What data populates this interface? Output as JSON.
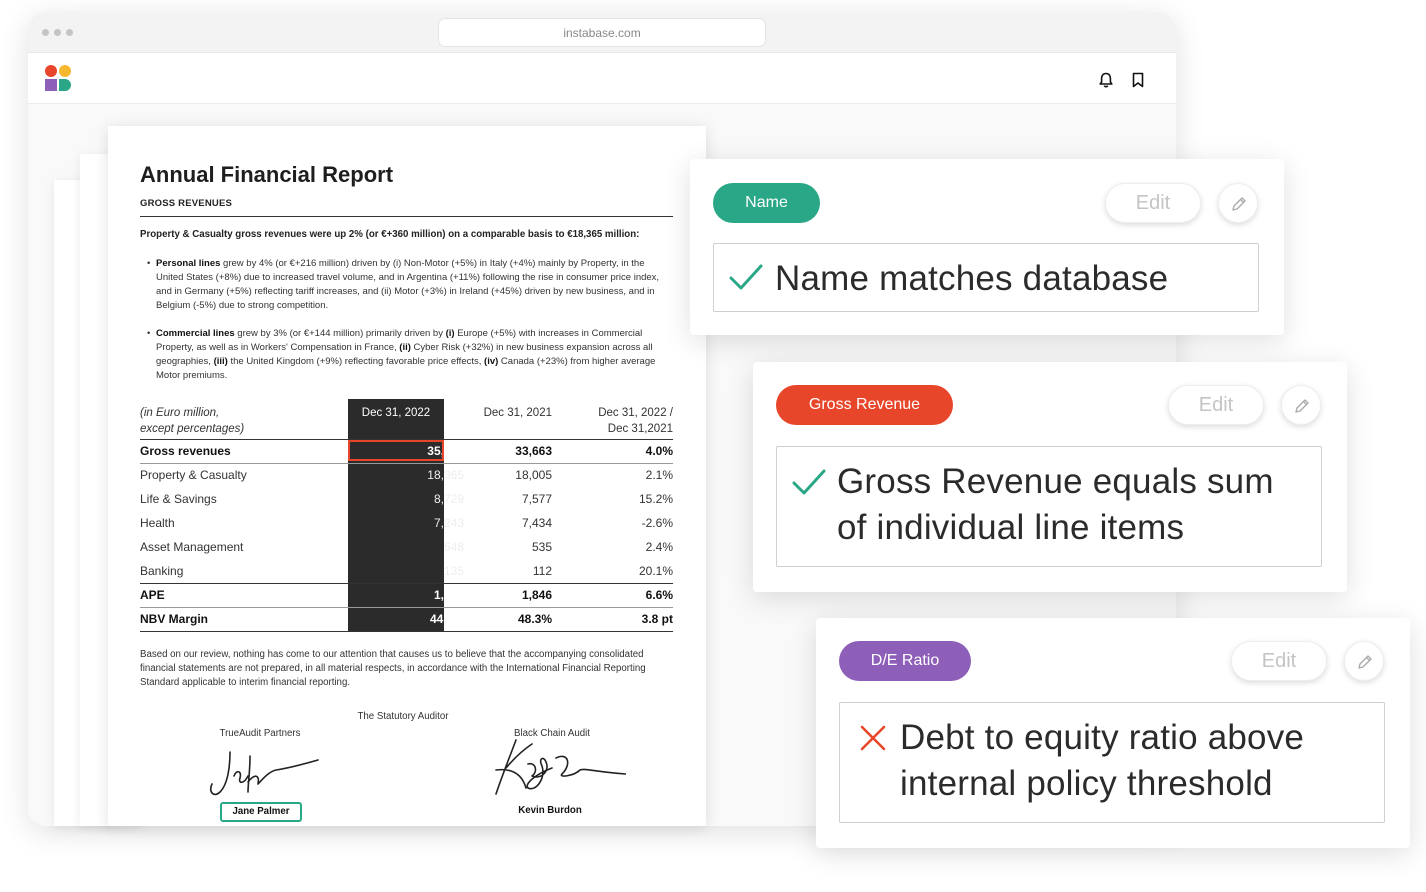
{
  "browser": {
    "url": "instabase.com"
  },
  "document": {
    "title": "Annual Financial Report",
    "section": "GROSS REVENUES",
    "lead": "Property & Casualty gross revenues were up 2% (or €+360 million) on a comparable basis to €18,365 million:",
    "bullets": [
      {
        "bold": "Personal lines",
        "text": " grew by 4% (or €+216 million) driven by (i) Non-Motor (+5%) in Italy (+4%) mainly by Property, in the United States (+8%) due to increased travel volume, and in Argentina (+11%) following the rise in consumer price index, and in Germany (+5%) reflecting tariff increases, and (ii) Motor (+3%) in Ireland (+45%) driven by new business, and in Belgium (-5%) due to strong competition."
      },
      {
        "bold": "Commercial lines",
        "text1": " grew by 3% (or €+144 million) primarily driven by ",
        "m1": "(i)",
        "text2": " Europe (+5%) with increases in Commercial Property, as well as in Workers' Compensation in France, ",
        "m2": "(ii)",
        "text3": " Cyber Risk (+32%) in new business expansion across all geographies, ",
        "m3": "(iii)",
        "text4": " the United Kingdom (+9%) reflecting favorable price effects, ",
        "m4": "(iv)",
        "text5": " Canada (+23%) from higher average Motor premiums."
      }
    ],
    "table": {
      "header_label_1": "(in Euro million,",
      "header_label_2": "except percentages)",
      "col1": "Dec 31, 2022",
      "col2": "Dec 31, 2021",
      "col3_1": "Dec 31, 2022 /",
      "col3_2": "Dec 31,2021",
      "rows": [
        {
          "label": "Gross revenues",
          "v1": "35,020",
          "v2": "33,663",
          "v3": "4.0%"
        },
        {
          "label": "Property & Casualty",
          "v1": "18,365",
          "v2": "18,005",
          "v3": "2.1%"
        },
        {
          "label": "Life & Savings",
          "v1": "8,729",
          "v2": "7,577",
          "v3": "15.2%"
        },
        {
          "label": "Health",
          "v1": "7,243",
          "v2": "7,434",
          "v3": "-2.6%"
        },
        {
          "label": "Asset Management",
          "v1": "548",
          "v2": "535",
          "v3": "2.4%"
        },
        {
          "label": "Banking",
          "v1": "135",
          "v2": "112",
          "v3": "20.1%"
        },
        {
          "label": "APE",
          "v1": "1,968",
          "v2": "1,846",
          "v3": "6.6%"
        },
        {
          "label": "NBV Margin",
          "v1": "44.5%",
          "v2": "48.3%",
          "v3": "3.8 pt"
        }
      ]
    },
    "footer": "Based on our review, nothing has come to our attention that causes us to believe that the accompanying consolidated financial statements are not prepared, in all material respects, in accordance with the International Financial Reporting Standard applicable to interim financial reporting.",
    "auditor": "The Statutory Auditor",
    "firm1": "TrueAudit Partners",
    "firm2": "Black Chain Audit",
    "signer1": "Jane Palmer",
    "signer2": "Kevin Burdon"
  },
  "cards": [
    {
      "tag": "Name",
      "tag_color": "#2aa786",
      "edit": "Edit",
      "status": "pass",
      "lines": [
        "Name matches database"
      ]
    },
    {
      "tag": "Gross Revenue",
      "tag_color": "#e8462a",
      "edit": "Edit",
      "status": "pass",
      "lines": [
        "Gross Revenue equals sum",
        "of individual line items"
      ]
    },
    {
      "tag": "D/E Ratio",
      "tag_color": "#8e5fb8",
      "edit": "Edit",
      "status": "fail",
      "lines": [
        "Debt to equity ratio above",
        "internal policy threshold"
      ]
    }
  ],
  "colors": {
    "pass": "#2aa786",
    "fail": "#e8462a",
    "highlight": "#e8462a"
  },
  "icons": [
    "bell-icon",
    "bookmark-icon",
    "pencil-icon",
    "check-icon",
    "x-icon"
  ]
}
